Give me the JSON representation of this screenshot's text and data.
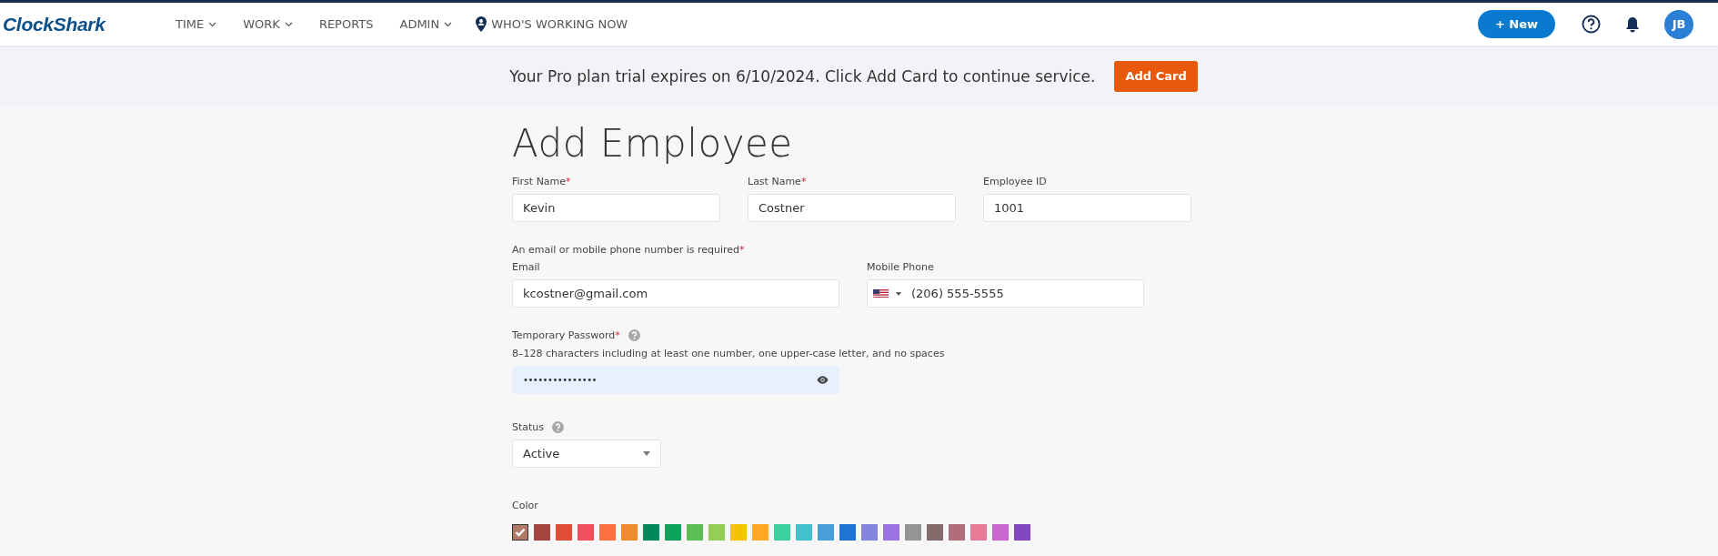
{
  "header": {
    "logo": "ClockShark",
    "nav": [
      {
        "label": "TIME",
        "dropdown": true,
        "kind": "menu"
      },
      {
        "label": "WORK",
        "dropdown": true,
        "kind": "menu"
      },
      {
        "label": "REPORTS",
        "dropdown": false,
        "kind": "menu"
      },
      {
        "label": "ADMIN",
        "dropdown": true,
        "kind": "menu"
      },
      {
        "label": "WHO'S WORKING NOW",
        "dropdown": false,
        "kind": "location"
      }
    ],
    "new_button": "+ New",
    "avatar": "JB"
  },
  "banner": {
    "message": "Your Pro plan trial expires on 6/10/2024. Click Add Card to continue service.",
    "button": "Add Card"
  },
  "form": {
    "title": "Add Employee",
    "rows": [
      {
        "fields": [
          {
            "kind": "text",
            "label": "First Name",
            "mark": "*",
            "value": "Kevin"
          },
          {
            "kind": "text",
            "label": "Last Name",
            "mark": "*",
            "value": "Costner"
          },
          {
            "kind": "text",
            "label": "Employee ID",
            "value": "1001"
          }
        ]
      },
      {
        "note": {
          "text": "An email or mobile phone number is required",
          "mark": "*"
        },
        "fields": [
          {
            "kind": "wide",
            "label": "Email",
            "value": "kcostner@gmail.com"
          },
          {
            "kind": "phone",
            "label": "Mobile Phone",
            "value": "(206) 555-5555"
          }
        ]
      },
      {
        "fields": [
          {
            "kind": "password",
            "label": "Temporary Password",
            "mark": "*",
            "hint": "8–128 characters including at least one number, one upper-case letter, and no spaces",
            "value": "•••••••••••••••"
          }
        ]
      },
      {
        "fields": [
          {
            "kind": "select",
            "label": "Status",
            "value": "Active"
          }
        ]
      }
    ],
    "color_label": "Color",
    "colors": [
      {
        "color": "#b07a66",
        "selected": true
      },
      {
        "color": "#a5453f",
        "selected": false
      },
      {
        "color": "#df4e38",
        "selected": false
      },
      {
        "color": "#f2505e",
        "selected": false
      },
      {
        "color": "#ff7043",
        "selected": false
      },
      {
        "color": "#ef8a2e",
        "selected": false
      },
      {
        "color": "#00875a",
        "selected": false
      },
      {
        "color": "#0ea35a",
        "selected": false
      },
      {
        "color": "#5cbf55",
        "selected": false
      },
      {
        "color": "#93cf57",
        "selected": false
      },
      {
        "color": "#f5c400",
        "selected": false
      },
      {
        "color": "#ffa726",
        "selected": false
      },
      {
        "color": "#3ccfa0",
        "selected": false
      },
      {
        "color": "#42c0cc",
        "selected": false
      },
      {
        "color": "#4a9ed6",
        "selected": false
      },
      {
        "color": "#1e74d2",
        "selected": false
      },
      {
        "color": "#8385dd",
        "selected": false
      },
      {
        "color": "#9b73e3",
        "selected": false
      },
      {
        "color": "#959595",
        "selected": false
      },
      {
        "color": "#846b6b",
        "selected": false
      },
      {
        "color": "#b26d7a",
        "selected": false
      },
      {
        "color": "#e97a98",
        "selected": false
      },
      {
        "color": "#cb68cf",
        "selected": false
      },
      {
        "color": "#8547c0",
        "selected": false
      }
    ]
  }
}
